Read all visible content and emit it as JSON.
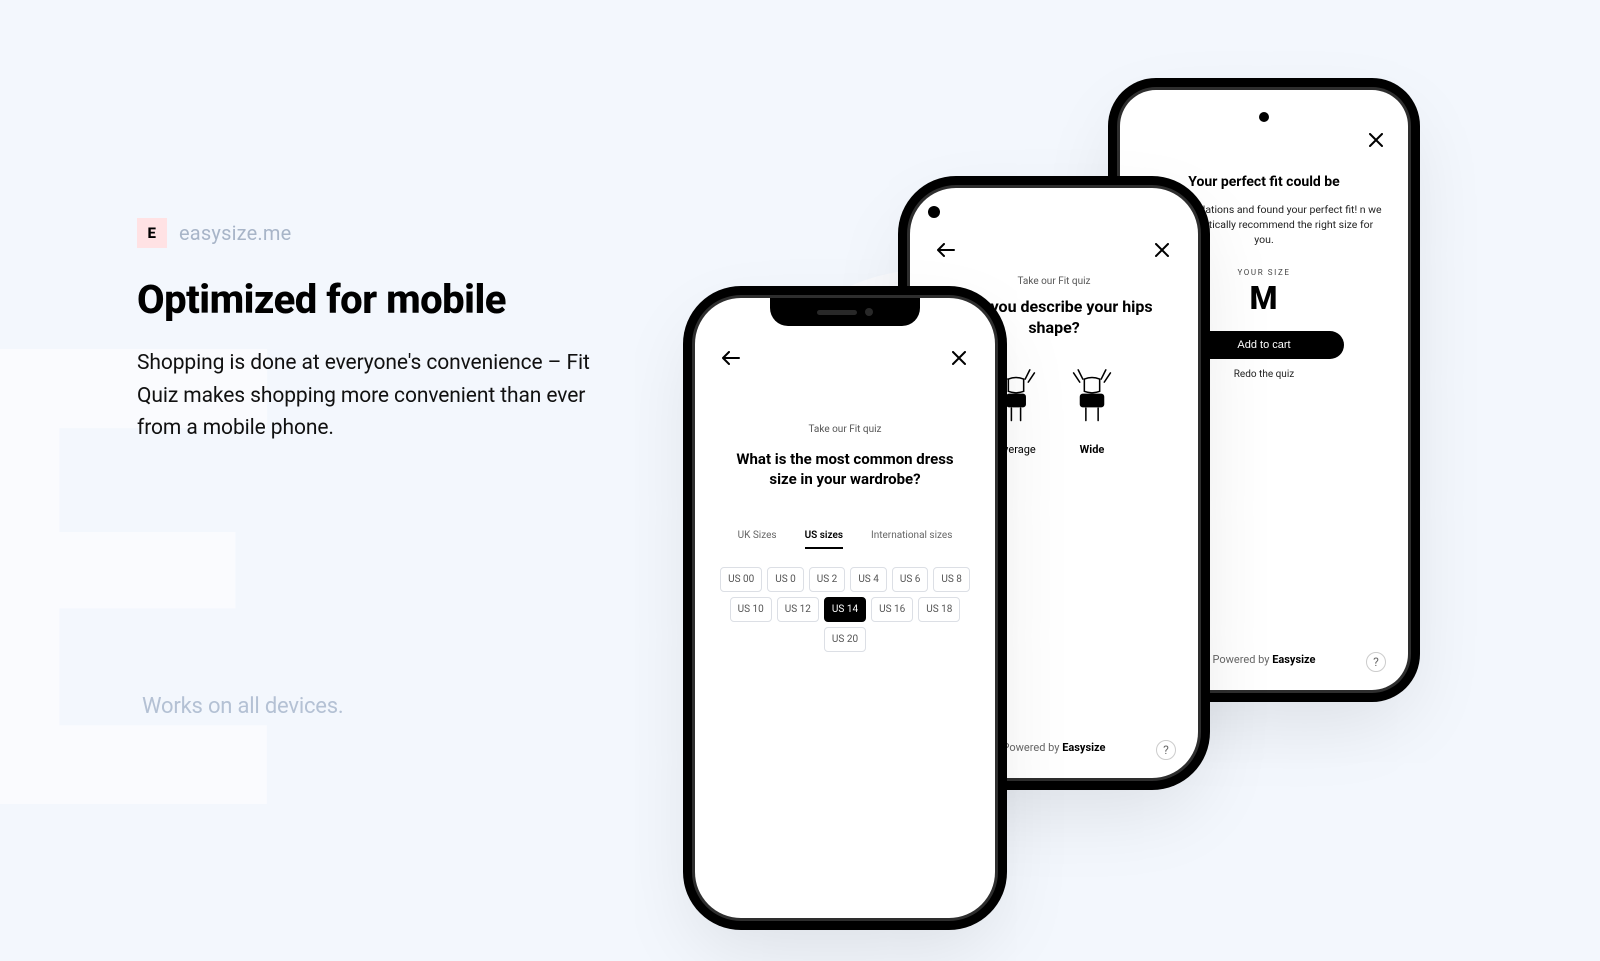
{
  "brand": {
    "badge": "E",
    "name": "easysize.me"
  },
  "headline": "Optimized for mobile",
  "body": "Shopping is done at everyone's convenience – Fit Quiz makes shopping more convenient than ever from a mobile phone.",
  "subnote": "Works on all devices.",
  "footer": {
    "prefix": "Powered by ",
    "brand": "Easysize"
  },
  "phone1": {
    "eyebrow": "Take our Fit quiz",
    "question": "What is the most common dress size in your wardrobe?",
    "tabs": [
      "UK Sizes",
      "US sizes",
      "International sizes"
    ],
    "active_tab": 1,
    "sizes": [
      "US 00",
      "US 0",
      "US 2",
      "US 4",
      "US 6",
      "US 8",
      "US 10",
      "US 12",
      "US 14",
      "US 16",
      "US 18",
      "US 20"
    ],
    "selected_size": "US 14"
  },
  "phone2": {
    "eyebrow": "Take our Fit quiz",
    "question": "ould you describe your hips shape?",
    "options": [
      "Average",
      "Wide"
    ],
    "selected_option": "Wide"
  },
  "phone3": {
    "title": "Your perfect fit could be",
    "desc": "ne the calculations and found your perfect fit! n we will automatically recommend the right size for you.",
    "label": "YOUR SIZE",
    "size": "M",
    "cta": "Add to cart",
    "redo": "Redo the quiz"
  }
}
